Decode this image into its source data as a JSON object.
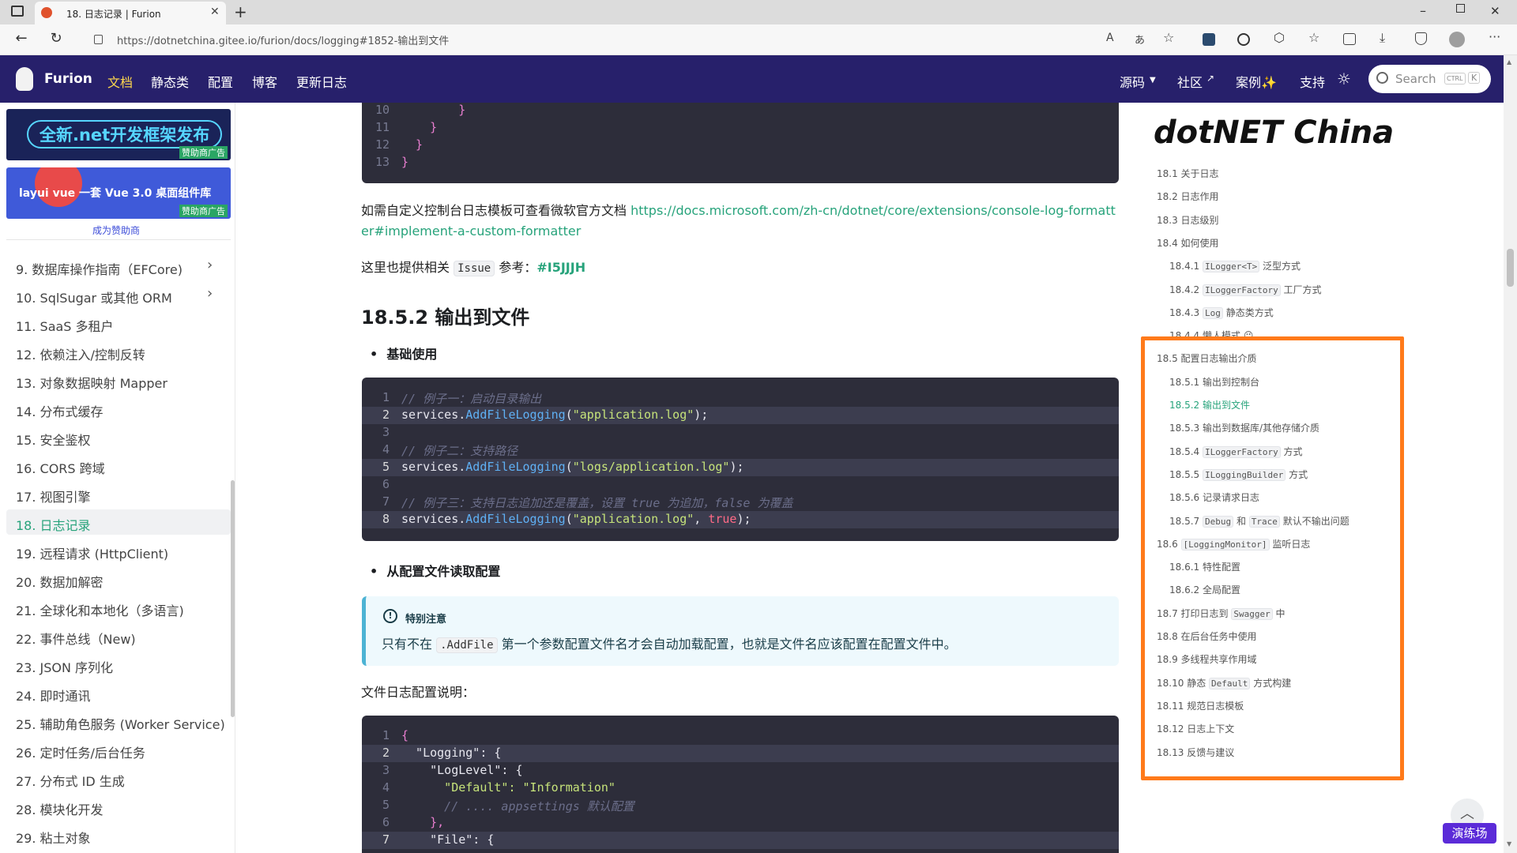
{
  "browser": {
    "tab_title": "18. 日志记录 | Furion",
    "url": "https://dotnetchina.gitee.io/furion/docs/logging#1852-输出到文件"
  },
  "site_nav": {
    "brand": "Furion",
    "items": [
      "文档",
      "静态类",
      "配置",
      "博客",
      "更新日志"
    ],
    "right_items": [
      "源码",
      "社区",
      "案例✨",
      "支持"
    ],
    "search_placeholder": "Search",
    "kbd_ctrl": "CTRL",
    "kbd_k": "K"
  },
  "sidebar": {
    "ad1_text": "全新.net开发框架发布",
    "ad1_badge": "赞助商广告",
    "ad2_text": "layui vue 一套 Vue 3.0 桌面组件库",
    "ad2_badge": "赞助商广告",
    "become_sponsor": "成为赞助商",
    "items": [
      "9. 数据库操作指南（EFCore)",
      "10. SqlSugar 或其他 ORM",
      "11. SaaS 多租户",
      "12. 依赖注入/控制反转",
      "13. 对象数据映射 Mapper",
      "14. 分布式缓存",
      "15. 安全鉴权",
      "16. CORS 跨域",
      "17. 视图引擎",
      "18. 日志记录",
      "19. 远程请求 (HttpClient)",
      "20. 数据加解密",
      "21. 全球化和本地化（多语言)",
      "22. 事件总线（New)",
      "23. JSON 序列化",
      "24. 即时通讯",
      "25. 辅助角色服务 (Worker Service)",
      "26. 定时任务/后台任务",
      "27. 分布式 ID 生成",
      "28. 模块化开发",
      "29. 粘土对象"
    ],
    "active_index": 9
  },
  "main": {
    "code_top_lines": [
      {
        "n": "10",
        "t": "        }"
      },
      {
        "n": "11",
        "t": "    }"
      },
      {
        "n": "12",
        "t": "  }"
      },
      {
        "n": "13",
        "t": "}"
      }
    ],
    "para1_prefix": "如需自定义控制台日志模板可查看微软官方文档 ",
    "para1_link": "https://docs.microsoft.com/zh-cn/dotnet/core/extensions/console-log-formatter#implement-a-custom-formatter",
    "para2_prefix": "这里也提供相关 ",
    "para2_code": "Issue",
    "para2_mid": " 参考：",
    "para2_link": "#I5JJJH",
    "heading": "18.5.2 输出到文件",
    "bullet1": "基础使用",
    "code1": {
      "lines": [
        {
          "n": "1",
          "comment": "// 例子一：启动目录输出"
        },
        {
          "n": "2",
          "obj": "services",
          "fn": "AddFileLogging",
          "arg": "\"application.log\"",
          "extra": "",
          "hl": true
        },
        {
          "n": "3"
        },
        {
          "n": "4",
          "comment": "// 例子二：支持路径"
        },
        {
          "n": "5",
          "obj": "services",
          "fn": "AddFileLogging",
          "arg": "\"logs/application.log\"",
          "extra": "",
          "hl": true
        },
        {
          "n": "6"
        },
        {
          "n": "7",
          "comment": "// 例子三：支持日志追加还是覆盖，设置 true 为追加，false 为覆盖"
        },
        {
          "n": "8",
          "obj": "services",
          "fn": "AddFileLogging",
          "arg": "\"application.log\"",
          "extra": "true",
          "hl": true
        }
      ]
    },
    "bullet2": "从配置文件读取配置",
    "note_title": "特别注意",
    "note_prefix": "只有不在 ",
    "note_code": ".AddFile",
    "note_suffix": " 第一个参数配置文件名才会自动加载配置，也就是文件名应该配置在配置文件中。",
    "para3": "文件日志配置说明：",
    "code2": {
      "lines": [
        {
          "n": "1",
          "t": "{"
        },
        {
          "n": "2",
          "t": "  \"Logging\": {",
          "hl": true
        },
        {
          "n": "3",
          "t": "    \"LogLevel\": {"
        },
        {
          "n": "4",
          "t": "      \"Default\": \"Information\""
        },
        {
          "n": "5",
          "t": "      // .... appsettings 默认配置"
        },
        {
          "n": "6",
          "t": "    },"
        },
        {
          "n": "7",
          "t": "    \"File\": {",
          "hl": true
        }
      ]
    }
  },
  "toc": {
    "logo_text_a": "dotNET",
    "logo_text_b": " Ch",
    "logo_text_c": "ina",
    "items": [
      {
        "num": "18.1",
        "label": "关于日志",
        "level": 1
      },
      {
        "num": "18.2",
        "label": "日志作用",
        "level": 1
      },
      {
        "num": "18.3",
        "label": "日志级别",
        "level": 1
      },
      {
        "num": "18.4",
        "label": "如何使用",
        "level": 1
      },
      {
        "num": "18.4.1",
        "code": "ILogger<T>",
        "label": " 泛型方式",
        "level": 2
      },
      {
        "num": "18.4.2",
        "code": "ILoggerFactory",
        "label": " 工厂方式",
        "level": 2
      },
      {
        "num": "18.4.3",
        "code": "Log",
        "label": " 静态类方式",
        "level": 2
      },
      {
        "num": "18.4.4",
        "label": "懒人模式 😉",
        "level": 2
      },
      {
        "num": "18.5",
        "label": "配置日志输出介质",
        "level": 1
      },
      {
        "num": "18.5.1",
        "label": "输出到控制台",
        "level": 2
      },
      {
        "num": "18.5.2",
        "label": "输出到文件",
        "level": 2,
        "active": true
      },
      {
        "num": "18.5.3",
        "label": "输出到数据库/其他存储介质",
        "level": 2
      },
      {
        "num": "18.5.4",
        "code": "ILoggerFactory",
        "label": " 方式",
        "level": 2
      },
      {
        "num": "18.5.5",
        "code": "ILoggingBuilder",
        "label": " 方式",
        "level": 2
      },
      {
        "num": "18.5.6",
        "label": "记录请求日志",
        "level": 2
      },
      {
        "num": "18.5.7",
        "code": "Debug",
        "label": " 和 ",
        "code2": "Trace",
        "label2": " 默认不输出问题",
        "level": 2
      },
      {
        "num": "18.6",
        "code": "[LoggingMonitor]",
        "label": " 监听日志",
        "level": 1
      },
      {
        "num": "18.6.1",
        "label": "特性配置",
        "level": 2
      },
      {
        "num": "18.6.2",
        "label": "全局配置",
        "level": 2
      },
      {
        "num": "18.7",
        "label": "打印日志到 ",
        "code": "Swagger",
        "label2": " 中",
        "level": 1
      },
      {
        "num": "18.8",
        "label": "在后台任务中使用",
        "level": 1
      },
      {
        "num": "18.9",
        "label": "多线程共享作用域",
        "level": 1
      },
      {
        "num": "18.10",
        "label": "静态 ",
        "code": "Default",
        "label2": " 方式构建",
        "level": 1
      },
      {
        "num": "18.11",
        "label": "规范日志模板",
        "level": 1
      },
      {
        "num": "18.12",
        "label": "日志上下文",
        "level": 1
      },
      {
        "num": "18.13",
        "label": "反馈与建议",
        "level": 1
      }
    ]
  },
  "playground_label": "演练场",
  "colors": {
    "nav_bg": "#27206b",
    "accent_green": "#27a37b",
    "highlight_orange": "#ff7a1a",
    "code_bg": "#2d2d3a",
    "nav_active": "#ffd84d"
  }
}
